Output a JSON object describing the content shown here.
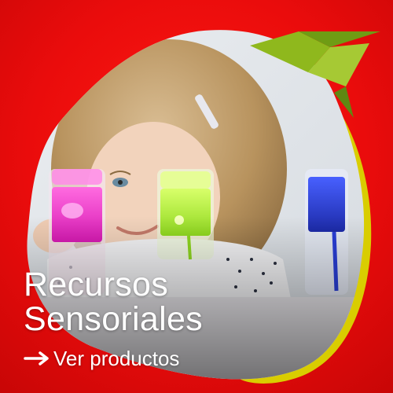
{
  "banner": {
    "title_line1": "Recursos",
    "title_line2": "Sensoriales",
    "cta_label": "Ver productos",
    "background_color": "#e80c0c",
    "accent_yellow": "#d8cc00",
    "bird_green": "#8fb81d",
    "icons": {
      "arrow": "arrow-right-icon",
      "logo": "hummingbird-logo"
    }
  },
  "photo": {
    "toys": [
      {
        "name": "pink",
        "color": "#ff3fd0"
      },
      {
        "name": "green",
        "color": "#b8f040"
      },
      {
        "name": "blue",
        "color": "#2a3fd8"
      }
    ]
  }
}
